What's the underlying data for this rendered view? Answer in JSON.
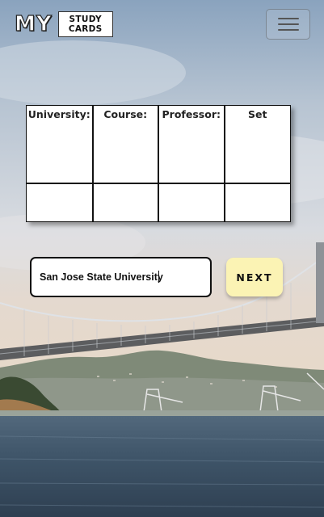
{
  "header": {
    "logo_my": "MY",
    "logo_line1": "STUDY",
    "logo_line2": "CARDS",
    "menu_icon": "hamburger-menu-icon"
  },
  "table": {
    "columns": [
      "University:",
      "Course:",
      "Professor:",
      "Set"
    ]
  },
  "form": {
    "university_value": "San Jose State University",
    "next_label": "NEXT"
  },
  "colors": {
    "next_button": "#fbf3b4",
    "text": "#111111"
  }
}
